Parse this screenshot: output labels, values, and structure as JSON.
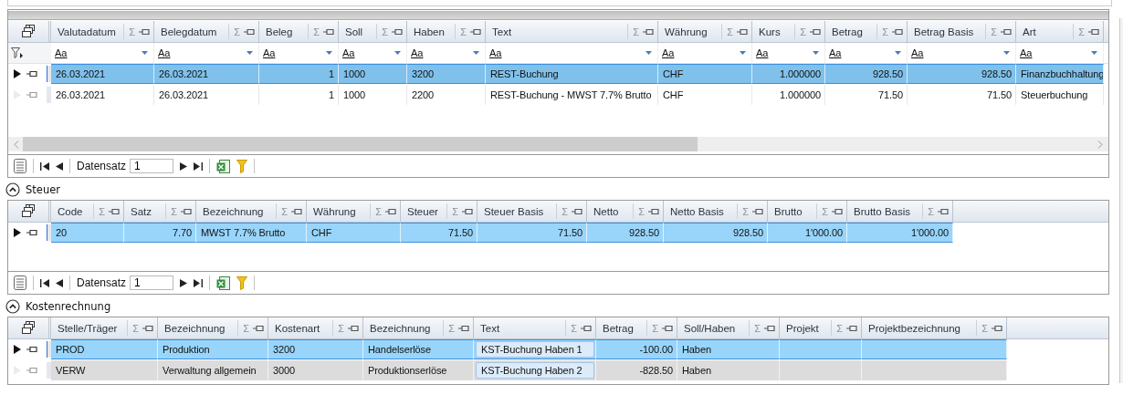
{
  "panels": [
    {
      "columns": [
        {
          "label": "Valutadatum",
          "sum": "Σ",
          "kind": "text"
        },
        {
          "label": "Belegdatum",
          "sum": "Σ",
          "kind": "text"
        },
        {
          "label": "Beleg",
          "sum": "Σ",
          "kind": "number"
        },
        {
          "label": "Soll",
          "sum": "Σ",
          "kind": "text"
        },
        {
          "label": "Haben",
          "sum": "Σ",
          "kind": "text"
        },
        {
          "label": "Text",
          "sum": "Σ",
          "kind": "text"
        },
        {
          "label": "Währung",
          "sum": "Σ",
          "kind": "text"
        },
        {
          "label": "Kurs",
          "sum": "Σ",
          "kind": "number"
        },
        {
          "label": "Betrag",
          "sum": "Σ",
          "kind": "number"
        },
        {
          "label": "Betrag Basis",
          "sum": "Σ",
          "kind": "number"
        },
        {
          "label": "Art",
          "sum": "Σ",
          "kind": "text"
        }
      ],
      "filter_row": [
        "Aa",
        "Aa",
        "Aa",
        "Aa",
        "Aa",
        "Aa",
        "Aa",
        "Aa",
        "Aa",
        "Aa",
        "Aa"
      ],
      "rows": [
        {
          "current": true,
          "selected": true,
          "cells": [
            "26.03.2021",
            "26.03.2021",
            "1",
            "1000",
            "3200",
            "REST-Buchung",
            "CHF",
            "1.000000",
            "928.50",
            "928.50",
            "Finanzbuchhaltung"
          ]
        },
        {
          "current": false,
          "selected": false,
          "cells": [
            "26.03.2021",
            "26.03.2021",
            "1",
            "1000",
            "2200",
            "REST-Buchung - MWST 7.7% Brutto",
            "CHF",
            "1.000000",
            "71.50",
            "71.50",
            "Steuerbuchung"
          ]
        }
      ],
      "horizontal_scrollbar": true,
      "pager": {
        "label": "Datensatz",
        "value": "1"
      }
    },
    {
      "title": "Steuer",
      "expanded": true,
      "columns": [
        {
          "label": "Code",
          "sum": "Σ",
          "kind": "text"
        },
        {
          "label": "Satz",
          "sum": "Σ",
          "kind": "number"
        },
        {
          "label": "Bezeichnung",
          "sum": "Σ",
          "kind": "text"
        },
        {
          "label": "Währung",
          "sum": "Σ",
          "kind": "text"
        },
        {
          "label": "Steuer",
          "sum": "Σ",
          "kind": "number"
        },
        {
          "label": "Steuer Basis",
          "sum": "Σ",
          "kind": "number"
        },
        {
          "label": "Netto",
          "sum": "Σ",
          "kind": "number"
        },
        {
          "label": "Netto Basis",
          "sum": "Σ",
          "kind": "number"
        },
        {
          "label": "Brutto",
          "sum": "Σ",
          "kind": "number"
        },
        {
          "label": "Brutto Basis",
          "sum": "Σ",
          "kind": "number"
        }
      ],
      "rows": [
        {
          "current": true,
          "selected": true,
          "cells": [
            "20",
            "7.70",
            "MWST 7.7% Brutto",
            "CHF",
            "71.50",
            "71.50",
            "928.50",
            "928.50",
            "1'000.00",
            "1'000.00"
          ]
        }
      ],
      "pager": {
        "label": "Datensatz",
        "value": "1"
      }
    },
    {
      "title": "Kostenrechnung",
      "expanded": true,
      "columns": [
        {
          "label": "Stelle/Träger",
          "sum": "Σ",
          "kind": "text"
        },
        {
          "label": "Bezeichnung",
          "sum": "Σ",
          "kind": "text"
        },
        {
          "label": "Kostenart",
          "sum": "Σ",
          "kind": "text"
        },
        {
          "label": "Bezeichnung",
          "sum": "Σ",
          "kind": "text"
        },
        {
          "label": "Text",
          "sum": "Σ",
          "kind": "input"
        },
        {
          "label": "Betrag",
          "sum": "Σ",
          "kind": "number"
        },
        {
          "label": "Soll/Haben",
          "sum": "Σ",
          "kind": "text"
        },
        {
          "label": "Projekt",
          "sum": "Σ",
          "kind": "text"
        },
        {
          "label": "Projektbezeichnung",
          "sum": "Σ",
          "kind": "text"
        }
      ],
      "rows": [
        {
          "current": true,
          "selected": true,
          "shaded": false,
          "cells": [
            "PROD",
            "Produktion",
            "3200",
            "Handelserlöse",
            "KST-Buchung Haben 1",
            "-100.00",
            "Haben",
            null,
            null
          ]
        },
        {
          "current": false,
          "selected": false,
          "shaded": true,
          "cells": [
            "VERW",
            "Verwaltung allgemein",
            "3000",
            "Produktionserlöse",
            "KST-Buchung Haben 2",
            "-828.50",
            "Haben",
            null,
            null
          ]
        }
      ]
    }
  ]
}
